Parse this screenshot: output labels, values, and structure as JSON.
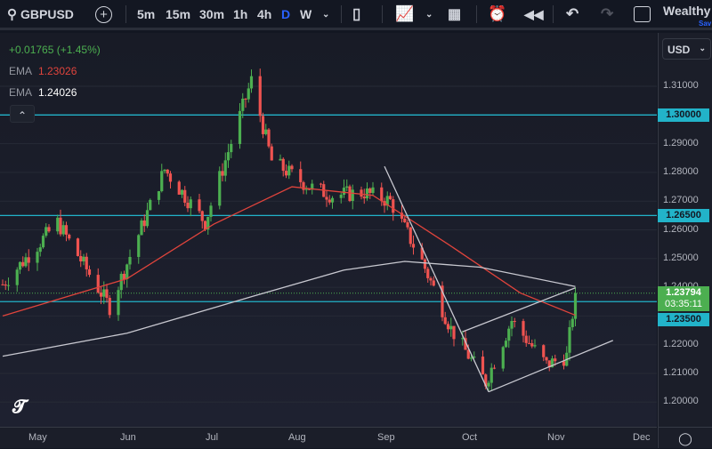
{
  "toolbar": {
    "symbol": "GBPUSD",
    "intervals": [
      "5m",
      "15m",
      "30m",
      "1h",
      "4h",
      "D",
      "W"
    ],
    "active_interval": "D",
    "account": "Wealthy",
    "account_sub": "Sav"
  },
  "legend": {
    "change": "+0.01765 (+1.45%)",
    "ema1_label": "EMA",
    "ema1_value": "1.23026",
    "ema2_label": "EMA",
    "ema2_value": "1.24026"
  },
  "currency": "USD",
  "colors": {
    "up": "#26a69a",
    "up_candle": "#4caf50",
    "down": "#ef5350",
    "ema_fast": "#e0443c",
    "ema_slow": "#c8c8d0",
    "hline": "#22b3c9",
    "accent_interval": "#2962ff"
  },
  "price_axis": {
    "labels": [
      "1.31000",
      "1.29000",
      "1.28000",
      "1.27000",
      "1.26000",
      "1.25000",
      "1.24000",
      "1.22000",
      "1.21000",
      "1.20000"
    ],
    "values": [
      1.31,
      1.29,
      1.28,
      1.27,
      1.26,
      1.25,
      1.24,
      1.22,
      1.21,
      1.2
    ]
  },
  "horizontal_lines": [
    {
      "value": 1.3,
      "label": "1.30000"
    },
    {
      "value": 1.265,
      "label": "1.26500"
    },
    {
      "value": 1.235,
      "label": "1.23500"
    }
  ],
  "last_price": {
    "value": 1.23794,
    "label": "1.23794",
    "countdown": "03:35:11"
  },
  "time_axis": {
    "labels": [
      "May",
      "Jun",
      "Jul",
      "Aug",
      "Sep",
      "Oct",
      "Nov",
      "Dec"
    ]
  },
  "chart_data": {
    "type": "candlestick",
    "symbol": "GBPUSD",
    "interval": "D",
    "ylim": [
      1.195,
      1.318
    ],
    "close_path": [
      [
        "2023-04-19",
        1.241
      ],
      [
        "2023-05-08",
        1.2626
      ],
      [
        "2023-05-26",
        1.2332
      ],
      [
        "2023-06-14",
        1.281
      ],
      [
        "2023-06-28",
        1.2626
      ],
      [
        "2023-07-14",
        1.312
      ],
      [
        "2023-07-21",
        1.284
      ],
      [
        "2023-08-03",
        1.275
      ],
      [
        "2023-08-11",
        1.272
      ],
      [
        "2023-08-22",
        1.273
      ],
      [
        "2023-08-31",
        1.27
      ],
      [
        "2023-09-11",
        1.249
      ],
      [
        "2023-09-21",
        1.2255
      ],
      [
        "2023-10-03",
        1.207
      ],
      [
        "2023-10-12",
        1.2285
      ],
      [
        "2023-10-24",
        1.213
      ],
      [
        "2023-10-31",
        1.216
      ],
      [
        "2023-11-03",
        1.23794
      ]
    ],
    "ema_fast": [
      [
        "2023-04-19",
        1.23
      ],
      [
        "2023-06-01",
        1.243
      ],
      [
        "2023-07-01",
        1.262
      ],
      [
        "2023-07-28",
        1.275
      ],
      [
        "2023-08-25",
        1.272
      ],
      [
        "2023-09-20",
        1.255
      ],
      [
        "2023-10-15",
        1.238
      ],
      [
        "2023-11-03",
        1.23026
      ]
    ],
    "ema_slow": [
      [
        "2023-04-19",
        1.216
      ],
      [
        "2023-06-01",
        1.224
      ],
      [
        "2023-07-15",
        1.237
      ],
      [
        "2023-08-15",
        1.246
      ],
      [
        "2023-09-05",
        1.249
      ],
      [
        "2023-10-01",
        1.247
      ],
      [
        "2023-11-03",
        1.24026
      ]
    ],
    "trendlines": [
      [
        [
          "2023-08-29",
          1.2821
        ],
        [
          "2023-10-04",
          1.2036
        ]
      ],
      [
        [
          "2023-10-04",
          1.2036
        ],
        [
          "2023-11-16",
          1.2215
        ]
      ],
      [
        [
          "2023-09-25",
          1.2245
        ],
        [
          "2023-11-03",
          1.2398
        ]
      ]
    ]
  }
}
